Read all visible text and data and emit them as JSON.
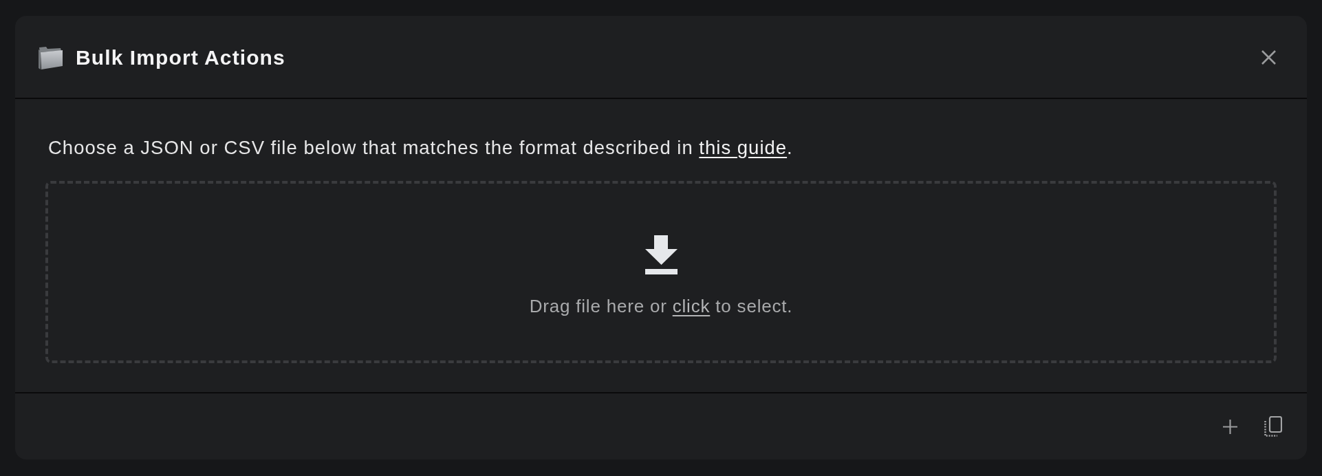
{
  "dialog": {
    "title": "Bulk Import Actions"
  },
  "description": {
    "text": "Choose a JSON or CSV file below that matches the format described in ",
    "link": "this guide",
    "suffix": "."
  },
  "dropzone": {
    "text": "Drag file here or ",
    "link": "click",
    "suffix": " to select."
  }
}
